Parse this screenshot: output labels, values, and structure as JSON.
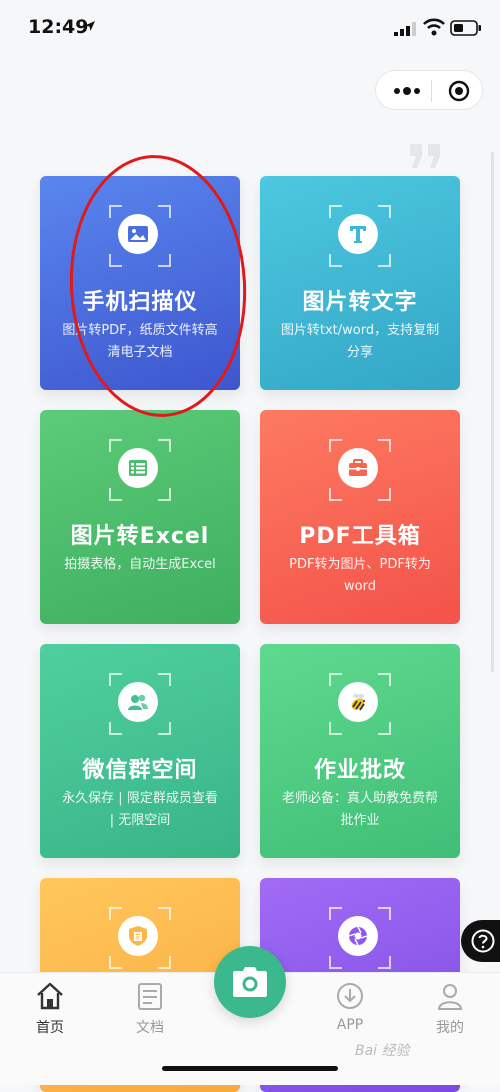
{
  "status_bar": {
    "time": "12:49"
  },
  "cards": [
    {
      "title": "手机扫描仪",
      "subtitle": "图片转PDF，纸质文件转高清电子文档",
      "icon": "image-icon",
      "color": "#4a6ee0"
    },
    {
      "title": "图片转文字",
      "subtitle": "图片转txt/word，支持复制分享",
      "icon": "text-t-icon",
      "color": "#3fb8d6"
    },
    {
      "title": "图片转Excel",
      "subtitle": "拍摄表格，自动生成Excel",
      "icon": "table-icon",
      "color": "#4cbd6c"
    },
    {
      "title": "PDF工具箱",
      "subtitle": "PDF转为图片、PDF转为word",
      "icon": "toolbox-icon",
      "color": "#f8654f"
    },
    {
      "title": "微信群空间",
      "subtitle": "永久保存 | 限定群成员查看 | 无限空间",
      "icon": "group-icon",
      "color": "#43c291"
    },
    {
      "title": "作业批改",
      "subtitle": "老师必备：真人助教免费帮批作业",
      "icon": "bee-icon",
      "color": "#4ccb80"
    },
    {
      "title": "",
      "subtitle": "",
      "icon": "shield-doc-icon",
      "color": "#fbb84a"
    },
    {
      "title": "",
      "subtitle": "",
      "icon": "aperture-icon",
      "color": "#8e5aeb"
    }
  ],
  "tabbar": {
    "items": [
      {
        "label": "首页",
        "icon": "home-icon",
        "active": true
      },
      {
        "label": "文档",
        "icon": "document-icon",
        "active": false
      },
      {
        "label": "APP",
        "icon": "download-icon",
        "active": false
      },
      {
        "label": "我的",
        "icon": "user-icon",
        "active": false
      }
    ],
    "center_icon": "camera-icon"
  },
  "watermark": "Bai 经验"
}
